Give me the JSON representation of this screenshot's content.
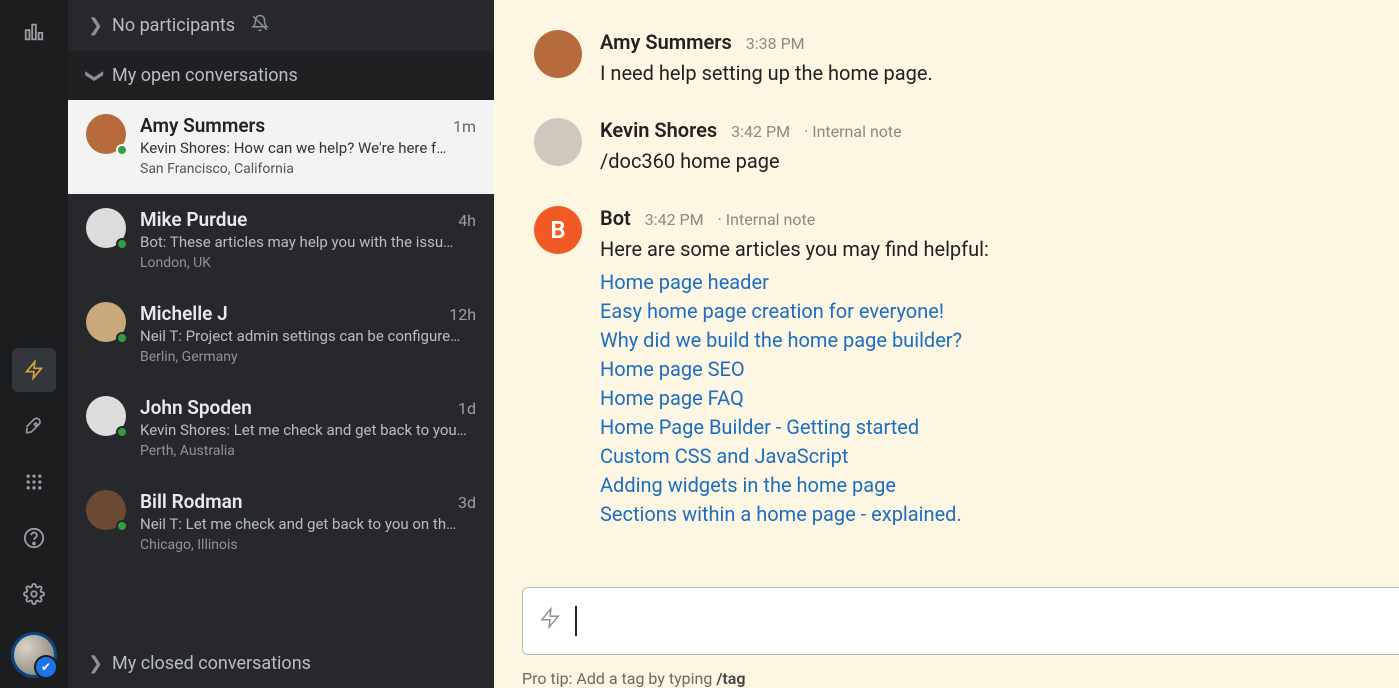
{
  "sections": {
    "no_participants": "No participants",
    "my_open": "My open conversations",
    "my_closed": "My closed conversations"
  },
  "conversations": [
    {
      "name": "Amy Summers",
      "time": "1m",
      "preview": "Kevin Shores: How can we help? We're here f…",
      "location": "San Francisco, California",
      "selected": true,
      "avatar_bg": "#b76b3d"
    },
    {
      "name": "Mike Purdue",
      "time": "4h",
      "preview": "Bot: These articles may help you with the issu…",
      "location": "London, UK",
      "selected": false,
      "avatar_bg": "#dcdcdc"
    },
    {
      "name": "Michelle J",
      "time": "12h",
      "preview": "Neil T: Project admin settings can be configure…",
      "location": "Berlin, Germany",
      "selected": false,
      "avatar_bg": "#c9a97a"
    },
    {
      "name": "John Spoden",
      "time": "1d",
      "preview": "Kevin Shores: Let me check and get back to you…",
      "location": "Perth, Australia",
      "selected": false,
      "avatar_bg": "#dcdcdc"
    },
    {
      "name": "Bill Rodman",
      "time": "3d",
      "preview": "Neil T: Let me check and get back to you on th…",
      "location": "Chicago, Illinois",
      "selected": false,
      "avatar_bg": "#6b4a34"
    }
  ],
  "messages": [
    {
      "author": "Amy Summers",
      "time": "3:38 PM",
      "internal_note": false,
      "avatar": "face",
      "avatar_bg": "#b76b3d",
      "text": "I need help setting up the home page.",
      "links": []
    },
    {
      "author": "Kevin Shores",
      "time": "3:42 PM",
      "internal_note": true,
      "avatar": "face",
      "avatar_bg": "#cfc8bf",
      "text": "/doc360 home page",
      "links": []
    },
    {
      "author": "Bot",
      "time": "3:42 PM",
      "internal_note": true,
      "avatar": "letter",
      "avatar_letter": "B",
      "avatar_bg": "#f15a24",
      "text": "Here are some articles you may find helpful:",
      "links": [
        "Home page header",
        "Easy home page creation for everyone!",
        "Why did we build the home page builder?",
        "Home page SEO",
        "Home page FAQ",
        "Home Page Builder - Getting started",
        "Custom CSS and JavaScript",
        "Adding widgets in the home page",
        "Sections within a home page - explained."
      ]
    }
  ],
  "composer": {
    "protip_prefix": "Pro tip: Add a tag by typing ",
    "protip_cmd": "/tag"
  }
}
